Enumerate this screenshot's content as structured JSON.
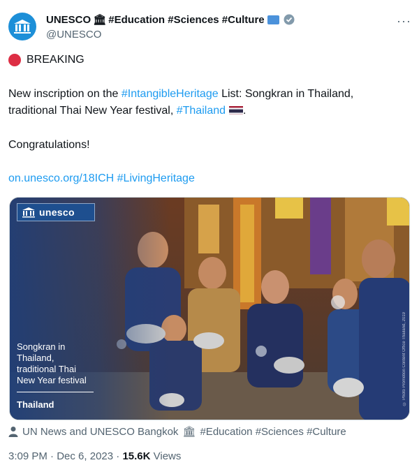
{
  "author": {
    "name": "UNESCO",
    "name_suffix": "#Education #Sciences #Culture",
    "handle": "@UNESCO",
    "more_label": "···"
  },
  "tweet": {
    "breaking": "BREAKING",
    "line1_prefix": "New inscription on the ",
    "line1_link": "#IntangibleHeritage",
    "line1_suffix": " List: Songkran in Thailand,",
    "line2_prefix": "traditional Thai New Year festival, ",
    "line2_link": "#Thailand",
    "line2_suffix": ".",
    "congrats": "Congratulations!",
    "url_link": "on.unesco.org/18ICH",
    "hashtag_link": "#LivingHeritage"
  },
  "media": {
    "logo_text": "unesco",
    "caption": "Songkran in Thailand, traditional Thai New Year festival",
    "country": "Thailand",
    "credit": "© Photo Promotion Content Office Thailand, 2019"
  },
  "tagged": {
    "text": "UN News and UNESCO Bangkok",
    "suffix": "#Education #Sciences #Culture"
  },
  "meta": {
    "time": "3:09 PM",
    "sep": " · ",
    "date": "Dec 6, 2023",
    "views_count": "15.6K",
    "views_label": " Views"
  },
  "icons": [
    "unesco-temple-icon",
    "classical-building-icon",
    "un-flag-icon",
    "verified-badge-icon",
    "thailand-flag-icon",
    "person-icon"
  ],
  "colors": {
    "link": "#1d9bf0",
    "muted": "#536471",
    "breaking": "#dd2e44",
    "avatar": "#1d8fd8"
  }
}
